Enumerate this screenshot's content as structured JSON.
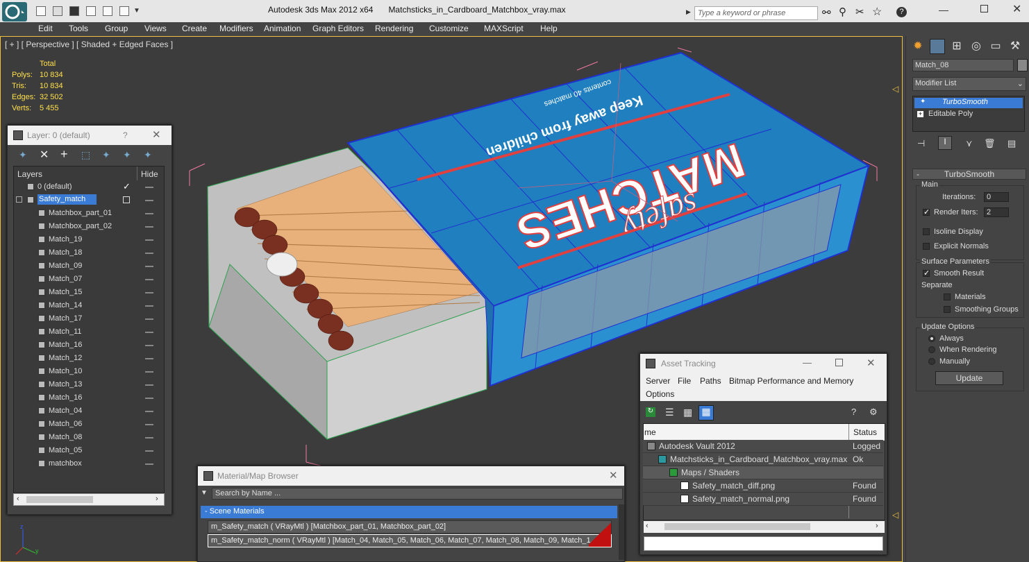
{
  "app": {
    "title": "Autodesk 3ds Max  2012 x64",
    "file": "Matchsticks_in_Cardboard_Matchbox_vray.max"
  },
  "search": {
    "placeholder": "Type a keyword or phrase"
  },
  "menu": [
    "Edit",
    "Tools",
    "Group",
    "Views",
    "Create",
    "Modifiers",
    "Animation",
    "Graph Editors",
    "Rendering",
    "Customize",
    "MAXScript",
    "Help"
  ],
  "viewport": {
    "label": "[ + ] [ Perspective ] [ Shaded + Edged Faces ]",
    "stats": {
      "header": "Total",
      "polys_label": "Polys:",
      "polys": "10 834",
      "tris_label": "Tris:",
      "tris": "10 834",
      "edges_label": "Edges:",
      "edges": "32 502",
      "verts_label": "Verts:",
      "verts": "5 455"
    },
    "box_text": {
      "brand": "MATCHES",
      "safety": "safety",
      "warning": "Keep away from children",
      "small": "contents 40 matches"
    }
  },
  "command_panel": {
    "object_name": "Match_08",
    "modifier_list": "Modifier List",
    "stack": [
      "TurboSmooth",
      "Editable Poly"
    ],
    "turbosmooth": {
      "title": "TurboSmooth",
      "main": "Main",
      "iterations_label": "Iterations:",
      "iterations": "0",
      "render_iters_label": "Render Iters:",
      "render_iters": "2",
      "isoline": "Isoline Display",
      "explicit_normals": "Explicit Normals",
      "surface_params": "Surface Parameters",
      "smooth_result": "Smooth Result",
      "separate": "Separate",
      "materials": "Materials",
      "smoothing_groups": "Smoothing Groups",
      "update_options": "Update Options",
      "always": "Always",
      "when_rendering": "When Rendering",
      "manually": "Manually",
      "update": "Update"
    }
  },
  "layer_window": {
    "title": "Layer: 0 (default)",
    "help": "?",
    "col_layers": "Layers",
    "col_hide": "Hide",
    "rows": [
      "0 (default)",
      "Safety_match",
      "Matchbox_part_01",
      "Matchbox_part_02",
      "Match_19",
      "Match_18",
      "Match_09",
      "Match_07",
      "Match_15",
      "Match_14",
      "Match_17",
      "Match_11",
      "Match_16",
      "Match_12",
      "Match_10",
      "Match_13",
      "Match_16",
      "Match_04",
      "Match_06",
      "Match_08",
      "Match_05",
      "matchbox"
    ]
  },
  "material_browser": {
    "title": "Material/Map Browser",
    "search_placeholder": "Search by Name ...",
    "section": "- Scene Materials",
    "rows": [
      "m_Safety_match  ( VRayMtl )  [Matchbox_part_01, Matchbox_part_02]",
      "m_Safety_match_norm   ( VRayMtl )   [Match_04, Match_05, Match_06, Match_07, Match_08, Match_09, Match_1..."
    ]
  },
  "asset_tracking": {
    "title": "Asset Tracking",
    "menu": [
      "Server",
      "File",
      "Paths",
      "Bitmap Performance and Memory",
      "Options"
    ],
    "col_name": "me",
    "col_status": "Status",
    "rows": [
      {
        "name": "Autodesk Vault 2012",
        "status": "Logged"
      },
      {
        "name": "Matchsticks_in_Cardboard_Matchbox_vray.max",
        "status": "Ok"
      },
      {
        "name": "Maps / Shaders",
        "status": ""
      },
      {
        "name": "Safety_match_diff.png",
        "status": "Found"
      },
      {
        "name": "Safety_match_normal.png",
        "status": "Found"
      }
    ]
  },
  "colors": {
    "accent": "#f0c040",
    "selection": "#3a7bd5",
    "box_blue": "#1f7fbf",
    "wire_blue": "#2030d0",
    "stat_yellow": "#ffe04a"
  }
}
